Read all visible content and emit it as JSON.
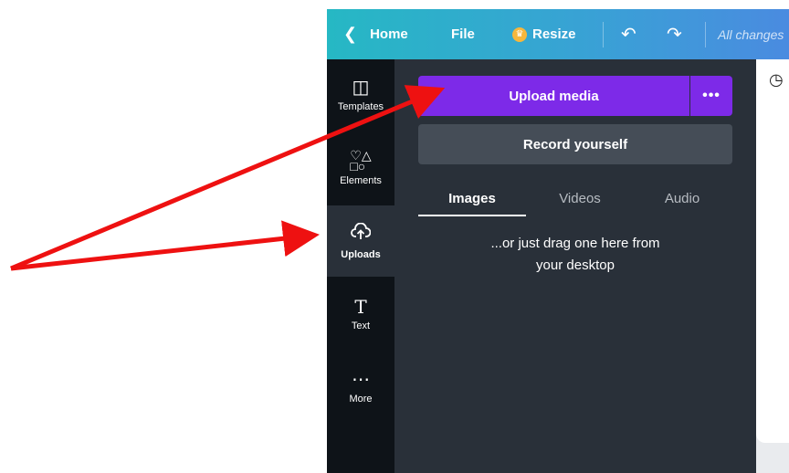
{
  "topbar": {
    "back_label": "Home",
    "file_label": "File",
    "resize_label": "Resize",
    "status": "All changes"
  },
  "rail": {
    "items": [
      {
        "label": "Templates",
        "icon": "templates-icon"
      },
      {
        "label": "Elements",
        "icon": "elements-icon"
      },
      {
        "label": "Uploads",
        "icon": "upload-cloud-icon"
      },
      {
        "label": "Text",
        "icon": "text-icon"
      },
      {
        "label": "More",
        "icon": "more-dots-icon"
      }
    ]
  },
  "panel": {
    "upload_label": "Upload media",
    "more_label": "•••",
    "record_label": "Record yourself",
    "tabs": [
      {
        "label": "Images",
        "active": true
      },
      {
        "label": "Videos",
        "active": false
      },
      {
        "label": "Audio",
        "active": false
      }
    ],
    "drag_line1": "...or just drag one here from",
    "drag_line2": "your desktop"
  },
  "colors": {
    "accent_purple": "#7d2ae8",
    "annotation_arrow": "#ee1111",
    "topbar_teal": "#26b8c4"
  }
}
